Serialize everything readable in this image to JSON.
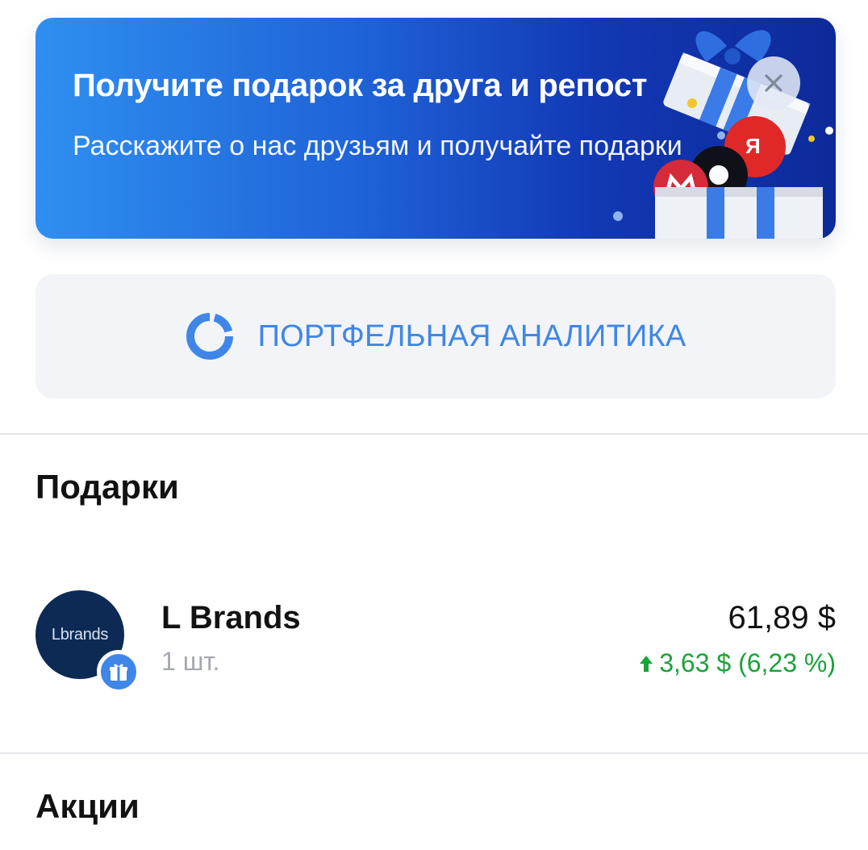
{
  "promo": {
    "title": "Получите подарок за друга и репост",
    "subtitle": "Расскажите о нас друзьям и получайте подарки",
    "close_icon": "close-icon",
    "art_icon": "gift-box-illustration"
  },
  "analytics": {
    "label": "ПОРТФЕЛЬНАЯ АНАЛИТИКА",
    "icon": "pie-ring-icon"
  },
  "gifts_section": {
    "title": "Подарки",
    "items": [
      {
        "logo_text": "Lbrands",
        "badge_icon": "gift-icon",
        "name": "L Brands",
        "quantity": "1 шт.",
        "price": "61,89 $",
        "change": "3,63 $ (6,23 %)",
        "change_direction_icon": "arrow-up-icon"
      }
    ]
  },
  "stocks_section": {
    "title": "Акции"
  },
  "colors": {
    "accent": "#3f86e8",
    "positive": "#1aa33a",
    "promo_start": "#2f8ff0",
    "promo_end": "#0d2a9a",
    "logo_bg": "#0d2a55"
  }
}
